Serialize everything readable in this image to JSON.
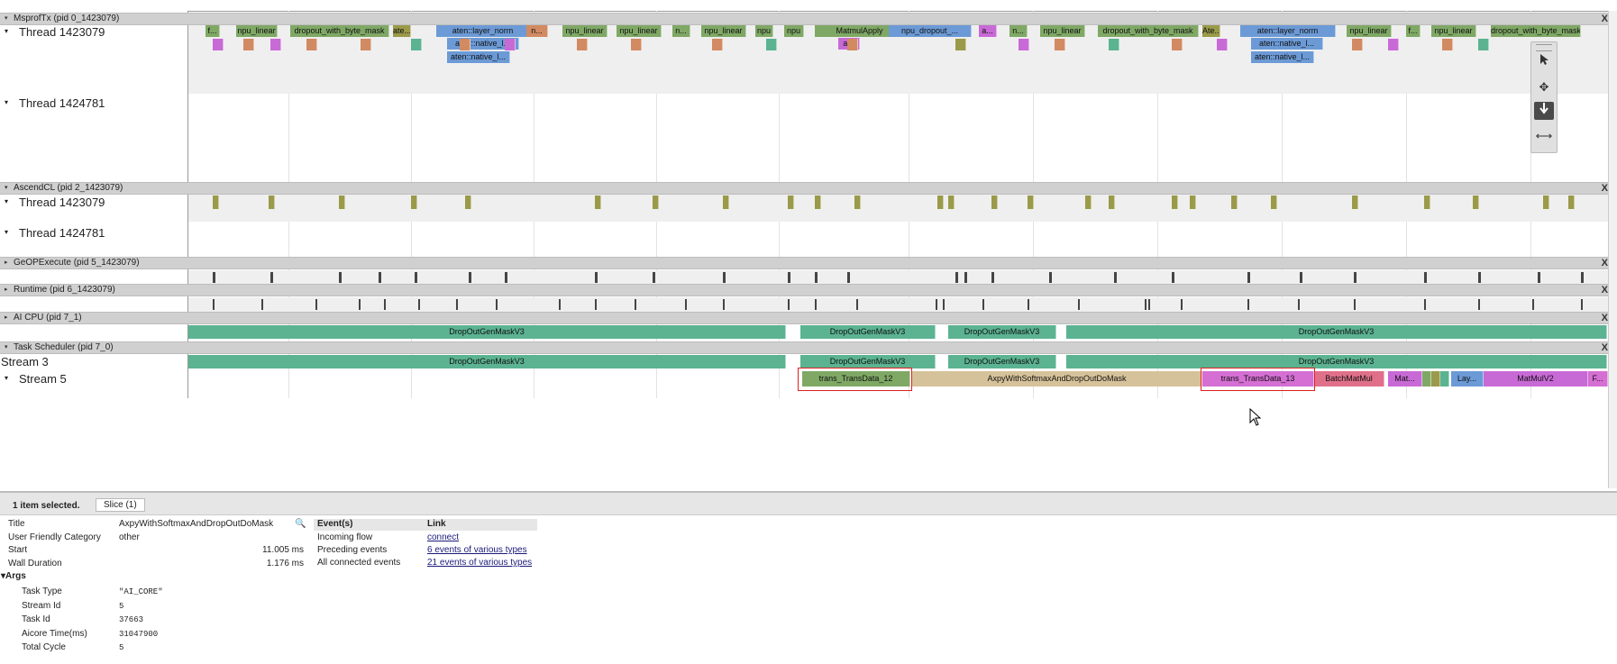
{
  "processes": [
    {
      "name": "MsprofTx (pid 0_1423079)",
      "threads": [
        "Thread 1423079",
        "Thread 1424781"
      ]
    },
    {
      "name": "AscendCL (pid 2_1423079)",
      "threads": [
        "Thread 1423079",
        "Thread 1424781"
      ]
    },
    {
      "name": "GeOPExecute (pid 5_1423079)",
      "threads": []
    },
    {
      "name": "Runtime (pid 6_1423079)",
      "threads": []
    },
    {
      "name": "AI CPU (pid 7_1)",
      "threads": []
    },
    {
      "name": "Task Scheduler (pid 7_0)",
      "threads": [
        "Stream 3",
        "Stream 5"
      ]
    }
  ],
  "close_glyph": "X",
  "msproftx_row1": [
    "f...",
    "npu_linear",
    "dropout_with_byte_mask",
    "ate...",
    "aten::layer_norm",
    "n...",
    "npu_linear",
    "npu_linear",
    "n...",
    "npu_linear",
    "npu",
    "npu",
    "MatmulApply",
    "npu_dropout_...",
    "a...",
    "n...",
    "npu_linear",
    "dropout_with_byte_mask",
    "Ate...",
    "aten::layer_norm",
    "npu_linear",
    "f...",
    "npu_linear",
    "dropout_with_byte_mask"
  ],
  "msproftx_row2": [
    "aten::native_l...",
    "a...",
    "aten::native_l..."
  ],
  "msproftx_row3": [
    "aten::native_l...",
    "aten::native_l..."
  ],
  "ai_cpu_slices": [
    "DropOutGenMaskV3",
    "DropOutGenMaskV3",
    "DropOutGenMaskV3",
    "DropOutGenMaskV3"
  ],
  "stream3_slices": [
    "DropOutGenMaskV3",
    "DropOutGenMaskV3",
    "DropOutGenMaskV3",
    "DropOutGenMaskV3"
  ],
  "stream5_slices": [
    "trans_TransData_12",
    "AxpyWithSoftmaxAndDropOutDoMask",
    "trans_TransData_13",
    "BatchMatMul",
    "Mat...",
    "Lay...",
    "MatMulV2",
    "F..."
  ],
  "colors": {
    "green": "#7fa865",
    "teal": "#5bb391",
    "blue": "#6c9ad6",
    "orange": "#d28a62",
    "olive": "#9a9a4a",
    "pink": "#c86ad6",
    "tan": "#d6c29a",
    "magenta": "#d56fd3",
    "red": "#e0708a",
    "track": "#efefef",
    "highlight": "#e02020"
  },
  "toolbar": {
    "icons": [
      "select-cursor-icon",
      "pan-icon",
      "zoom-icon",
      "timing-icon"
    ]
  },
  "panel": {
    "selection_text": "1 item selected.",
    "tab_label": "Slice (1)",
    "fields": [
      {
        "label": "Title",
        "value": "AxpyWithSoftmaxAndDropOutDoMask"
      },
      {
        "label": "User Friendly Category",
        "value": "other"
      },
      {
        "label": "Start",
        "value": "11.005 ms"
      },
      {
        "label": "Wall Duration",
        "value": "1.176 ms"
      }
    ],
    "args_label": "Args",
    "args": [
      {
        "label": "Task Type",
        "value": "\"AI_CORE\""
      },
      {
        "label": "Stream Id",
        "value": "5"
      },
      {
        "label": "Task Id",
        "value": "37663"
      },
      {
        "label": "Aicore Time(ms)",
        "value": "31047900"
      },
      {
        "label": "Total Cycle",
        "value": "5"
      }
    ],
    "events_header": "Event(s)",
    "link_header": "Link",
    "events": [
      {
        "label": "Incoming flow",
        "link": "connect"
      },
      {
        "label": "Preceding events",
        "link": "6 events of various types"
      },
      {
        "label": "All connected events",
        "link": "21 events of various types"
      }
    ]
  }
}
